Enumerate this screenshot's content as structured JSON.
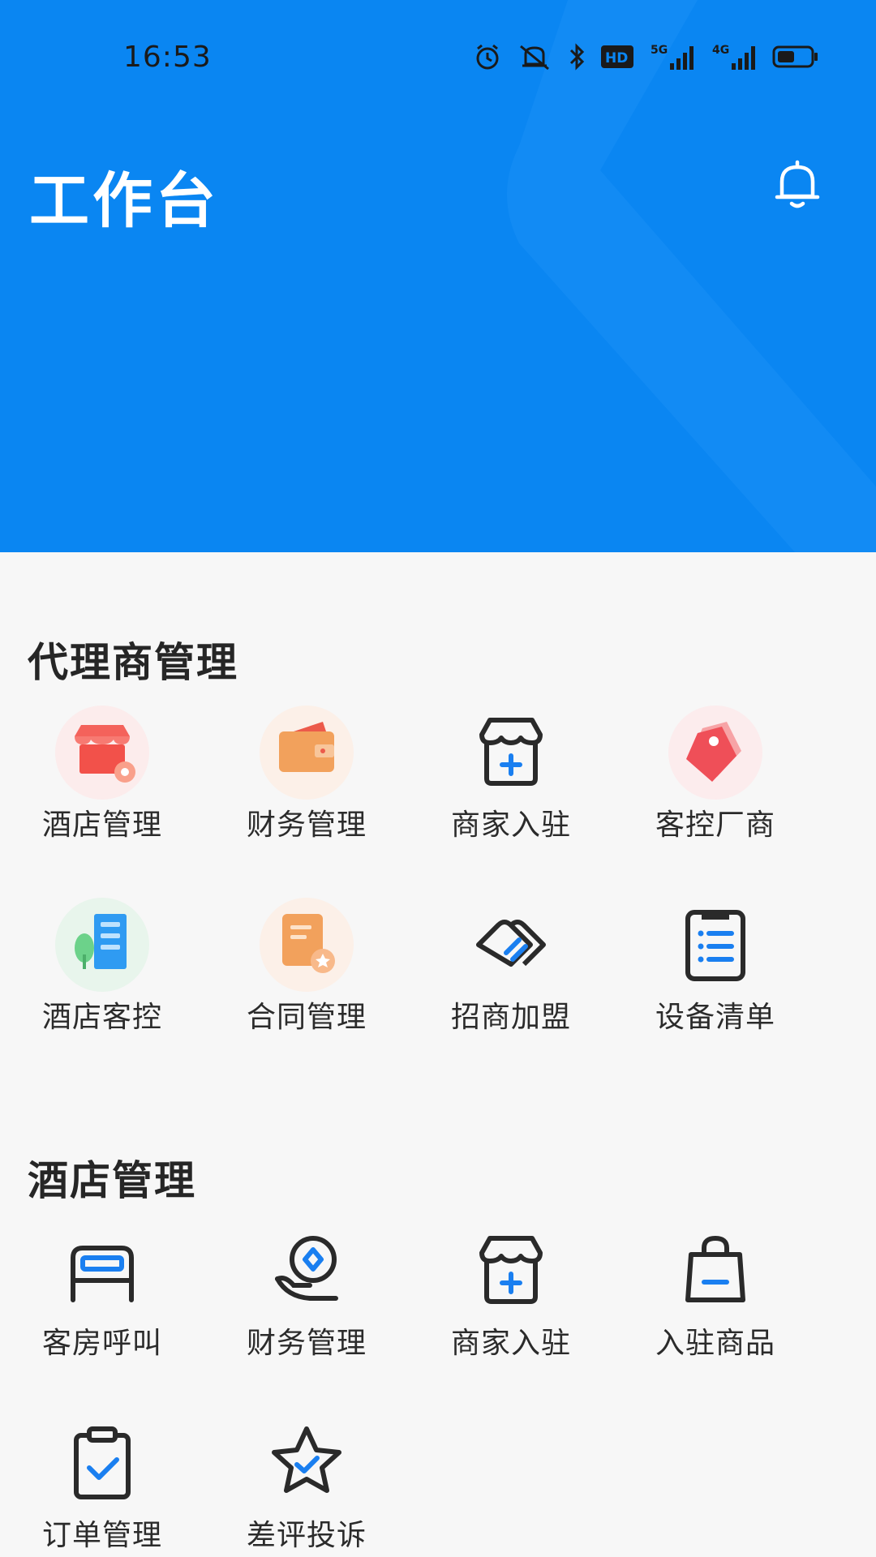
{
  "status_bar": {
    "time": "16:53",
    "icons": [
      "alarm-icon",
      "mute-icon",
      "bluetooth-icon",
      "hd-icon",
      "5g-signal-icon",
      "4g-signal-icon",
      "battery-icon"
    ],
    "hd_label": "HD",
    "network_5g": "5G",
    "network_4g": "4G"
  },
  "header": {
    "title": "工作台",
    "background_color": "#0a86f2",
    "bell_icon": "bell-icon"
  },
  "sections": [
    {
      "title": "代理商管理",
      "items": [
        {
          "label": "酒店管理",
          "icon": "store-settings-icon"
        },
        {
          "label": "财务管理",
          "icon": "wallet-icon"
        },
        {
          "label": "商家入驻",
          "icon": "shop-add-icon"
        },
        {
          "label": "客控厂商",
          "icon": "tag-icon"
        },
        {
          "label": "酒店客控",
          "icon": "building-icon"
        },
        {
          "label": "合同管理",
          "icon": "contract-icon"
        },
        {
          "label": "招商加盟",
          "icon": "handshake-icon"
        },
        {
          "label": "设备清单",
          "icon": "checklist-icon"
        }
      ]
    },
    {
      "title": "酒店管理",
      "items": [
        {
          "label": "客房呼叫",
          "icon": "bed-icon"
        },
        {
          "label": "财务管理",
          "icon": "hand-coin-icon"
        },
        {
          "label": "商家入驻",
          "icon": "shop-add-icon"
        },
        {
          "label": "入驻商品",
          "icon": "shopping-bag-icon"
        },
        {
          "label": "订单管理",
          "icon": "clipboard-check-icon"
        },
        {
          "label": "差评投诉",
          "icon": "star-check-icon"
        }
      ]
    }
  ],
  "colors": {
    "accent": "#1a7ff0",
    "icon_dark": "#2a2a2a"
  }
}
